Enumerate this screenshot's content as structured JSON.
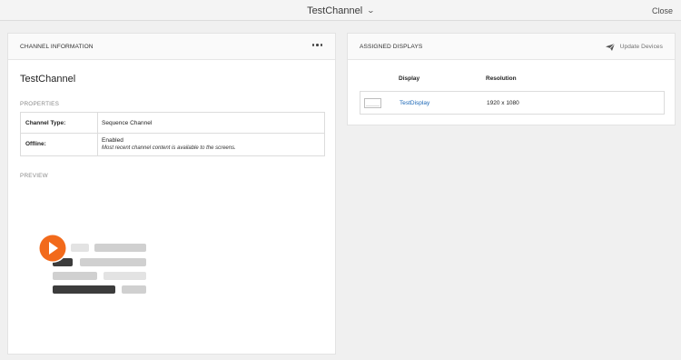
{
  "topbar": {
    "title": "TestChannel",
    "close_label": "Close"
  },
  "channel_panel": {
    "header": "CHANNEL INFORMATION",
    "channel_name": "TestChannel",
    "properties_label": "PROPERTIES",
    "properties": [
      {
        "key": "Channel Type:",
        "value": "Sequence Channel"
      },
      {
        "key": "Offline:",
        "value": "Enabled",
        "note": "Most recent channel content is available to the screens."
      }
    ],
    "preview_label": "PREVIEW"
  },
  "displays_panel": {
    "header": "ASSIGNED DISPLAYS",
    "update_label": "Update Devices",
    "columns": [
      "Display",
      "Resolution"
    ],
    "rows": [
      {
        "display": "TestDisplay",
        "resolution": "1920 x 1080"
      }
    ]
  },
  "colors": {
    "accent_orange": "#f26a1b",
    "link_blue": "#1b67b6"
  },
  "icons": [
    "chevron-down-icon",
    "more-options-icon",
    "send-icon",
    "display-thumbnail-icon",
    "play-icon"
  ]
}
